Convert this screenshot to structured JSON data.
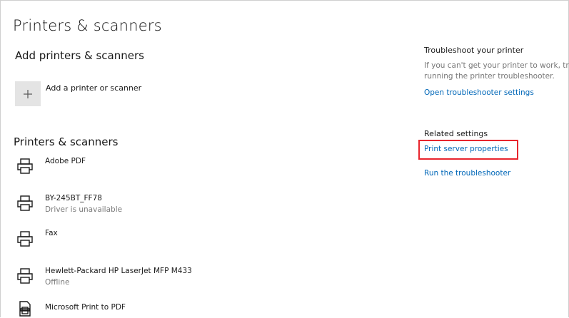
{
  "page": {
    "title": "Printers & scanners"
  },
  "add_section": {
    "title": "Add printers & scanners",
    "add_button_label": "Add a printer or scanner"
  },
  "printers_section": {
    "title": "Printers & scanners",
    "printers": [
      {
        "name": "Adobe PDF",
        "status": ""
      },
      {
        "name": "BY-245BT_FF78",
        "status": "Driver is unavailable"
      },
      {
        "name": "Fax",
        "status": ""
      },
      {
        "name": "Hewlett-Packard HP LaserJet MFP M433",
        "status": "Offline"
      },
      {
        "name": "Microsoft Print to PDF",
        "status": ""
      }
    ]
  },
  "sidebar": {
    "troubleshoot": {
      "heading": "Troubleshoot your printer",
      "description": "If you can't get your printer to work, try running the printer troubleshooter.",
      "link": "Open troubleshooter settings"
    },
    "related": {
      "heading": "Related settings",
      "links": [
        "Print server properties",
        "Run the troubleshooter"
      ]
    }
  },
  "colors": {
    "link": "#0067b8",
    "highlight_box": "#e8252d",
    "add_tile": "#e4e4e4"
  },
  "icons": {
    "add": "plus-icon",
    "printer": "printer-icon",
    "pdf_printer": "pdf-printer-icon"
  }
}
